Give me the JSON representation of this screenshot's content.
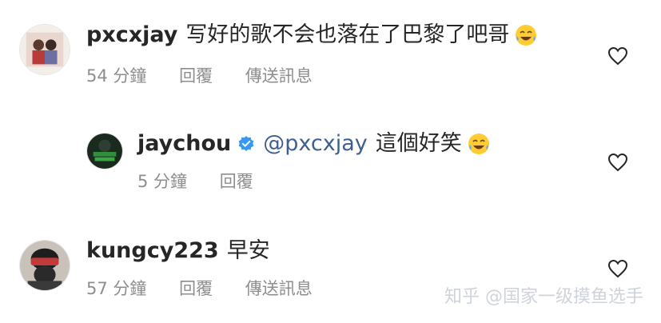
{
  "comments": [
    {
      "username": "pxcxjay",
      "text": "写好的歌不会也落在了巴黎了吧哥",
      "emoji": "laughing-tears-emoji",
      "time": "54 分鐘",
      "reply_label": "回覆",
      "send_label": "傳送訊息"
    },
    {
      "username": "jaychou",
      "verified": true,
      "mention": "@pxcxjay",
      "text": "這個好笑",
      "emoji": "laughing-tears-emoji",
      "time": "5 分鐘",
      "reply_label": "回覆"
    },
    {
      "username": "kungcy223",
      "text": "早安",
      "time": "57 分鐘",
      "reply_label": "回覆",
      "send_label": "傳送訊息"
    }
  ],
  "watermark": "知乎 @国家一级摸鱼选手",
  "icons": {
    "like": "heart-outline-icon",
    "verified": "verified-badge-icon"
  },
  "colors": {
    "text": "#262626",
    "meta": "#8e8e8e",
    "mention": "#3f5f8f",
    "verified": "#3897f0",
    "watermark": "#cfd3da"
  }
}
